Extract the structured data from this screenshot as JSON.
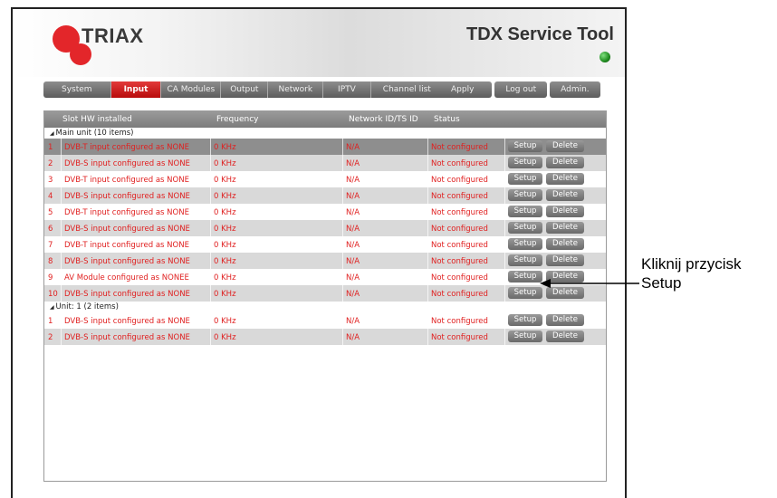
{
  "header": {
    "logo_text": "TRIAX",
    "app_title": "TDX Service Tool",
    "status_led_color": "#1e8a1e"
  },
  "nav": {
    "tabs": [
      {
        "label": "System",
        "active": false
      },
      {
        "label": "Input",
        "active": true
      },
      {
        "label": "CA Modules",
        "active": false
      },
      {
        "label": "Output",
        "active": false
      },
      {
        "label": "Network",
        "active": false
      },
      {
        "label": "IPTV",
        "active": false
      },
      {
        "label": "Channel list",
        "active": false
      }
    ],
    "apply_label": "Apply",
    "logout_label": "Log out",
    "admin_label": "Admin."
  },
  "table": {
    "columns": [
      "Slot HW installed",
      "Frequency",
      "Network ID/TS ID",
      "Status"
    ],
    "setup_label": "Setup",
    "delete_label": "Delete",
    "groups": [
      {
        "label": "Main unit (10 items)",
        "rows": [
          {
            "slot": "1",
            "hw": "DVB-T input configured as NONE",
            "freq": "0 KHz",
            "nid": "N/A",
            "status": "Not configured"
          },
          {
            "slot": "2",
            "hw": "DVB-S input configured as NONE",
            "freq": "0 KHz",
            "nid": "N/A",
            "status": "Not configured"
          },
          {
            "slot": "3",
            "hw": "DVB-T input configured as NONE",
            "freq": "0 KHz",
            "nid": "N/A",
            "status": "Not configured"
          },
          {
            "slot": "4",
            "hw": "DVB-S input configured as NONE",
            "freq": "0 KHz",
            "nid": "N/A",
            "status": "Not configured"
          },
          {
            "slot": "5",
            "hw": "DVB-T input configured as NONE",
            "freq": "0 KHz",
            "nid": "N/A",
            "status": "Not configured"
          },
          {
            "slot": "6",
            "hw": "DVB-S input configured as NONE",
            "freq": "0 KHz",
            "nid": "N/A",
            "status": "Not configured"
          },
          {
            "slot": "7",
            "hw": "DVB-T input configured as NONE",
            "freq": "0 KHz",
            "nid": "N/A",
            "status": "Not configured"
          },
          {
            "slot": "8",
            "hw": "DVB-S input configured as NONE",
            "freq": "0 KHz",
            "nid": "N/A",
            "status": "Not configured"
          },
          {
            "slot": "9",
            "hw": "AV Module configured as NONEE",
            "freq": "0 KHz",
            "nid": "N/A",
            "status": "Not configured"
          },
          {
            "slot": "10",
            "hw": "DVB-S input configured as NONE",
            "freq": "0 KHz",
            "nid": "N/A",
            "status": "Not configured"
          }
        ]
      },
      {
        "label": "Unit: 1 (2 items)",
        "rows": [
          {
            "slot": "1",
            "hw": "DVB-S input configured as NONE",
            "freq": "0 KHz",
            "nid": "N/A",
            "status": "Not configured"
          },
          {
            "slot": "2",
            "hw": "DVB-S input configured as NONE",
            "freq": "0 KHz",
            "nid": "N/A",
            "status": "Not configured"
          }
        ]
      }
    ]
  },
  "annotation": {
    "line1": "Kliknij przycisk",
    "line2": "Setup"
  },
  "colors": {
    "accent_red": "#d41e1e",
    "row_text_red": "#e02020"
  }
}
